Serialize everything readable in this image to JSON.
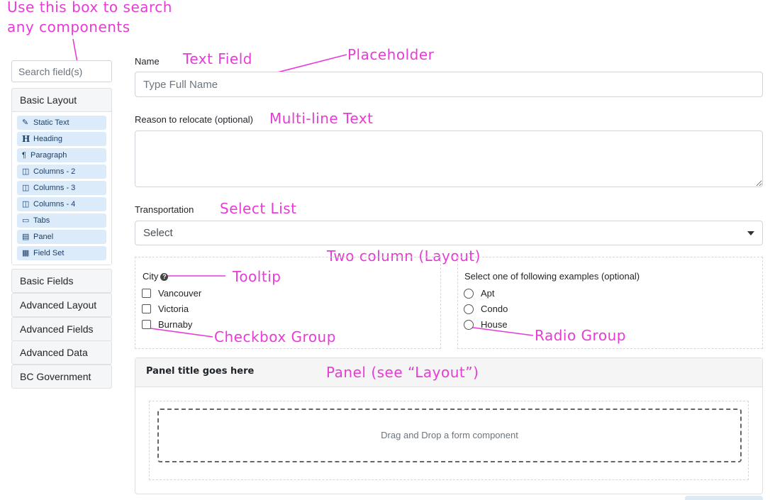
{
  "annotations": {
    "search_note_line1": "Use this box to search",
    "search_note_line2": "any components",
    "text_field": "Text Field",
    "placeholder": "Placeholder",
    "multiline": "Multi-line Text",
    "select_list": "Select List",
    "two_column": "Two column (Layout)",
    "tooltip": "Tooltip",
    "checkbox_group": "Checkbox Group",
    "radio_group": "Radio Group",
    "panel": "Panel (see “Layout”)",
    "color": "#e83bd6"
  },
  "sidebar": {
    "search_placeholder": "Search field(s)",
    "basic_layout": {
      "label": "Basic Layout",
      "items": [
        {
          "label": "Static Text",
          "icon": "edit-icon"
        },
        {
          "label": "Heading",
          "icon": "heading-icon"
        },
        {
          "label": "Paragraph",
          "icon": "paragraph-icon"
        },
        {
          "label": "Columns - 2",
          "icon": "columns-icon"
        },
        {
          "label": "Columns - 3",
          "icon": "columns-icon"
        },
        {
          "label": "Columns - 4",
          "icon": "columns-icon"
        },
        {
          "label": "Tabs",
          "icon": "folder-icon"
        },
        {
          "label": "Panel",
          "icon": "panel-icon"
        },
        {
          "label": "Field Set",
          "icon": "grid-icon"
        }
      ]
    },
    "groups": [
      "Basic Fields",
      "Advanced Layout",
      "Advanced Fields",
      "Advanced Data",
      "BC Government"
    ]
  },
  "form": {
    "name_label": "Name",
    "name_placeholder": "Type Full Name",
    "reason_label": "Reason to relocate (optional)",
    "transport_label": "Transportation",
    "transport_value": "Select",
    "city_label": "City",
    "cities": [
      "Vancouver",
      "Victoria",
      "Burnaby"
    ],
    "examples_label": "Select one of following examples (optional)",
    "examples": [
      "Apt",
      "Condo",
      "House"
    ],
    "panel_title": "Panel title goes here",
    "drop_text": "Drag and Drop a form component"
  }
}
